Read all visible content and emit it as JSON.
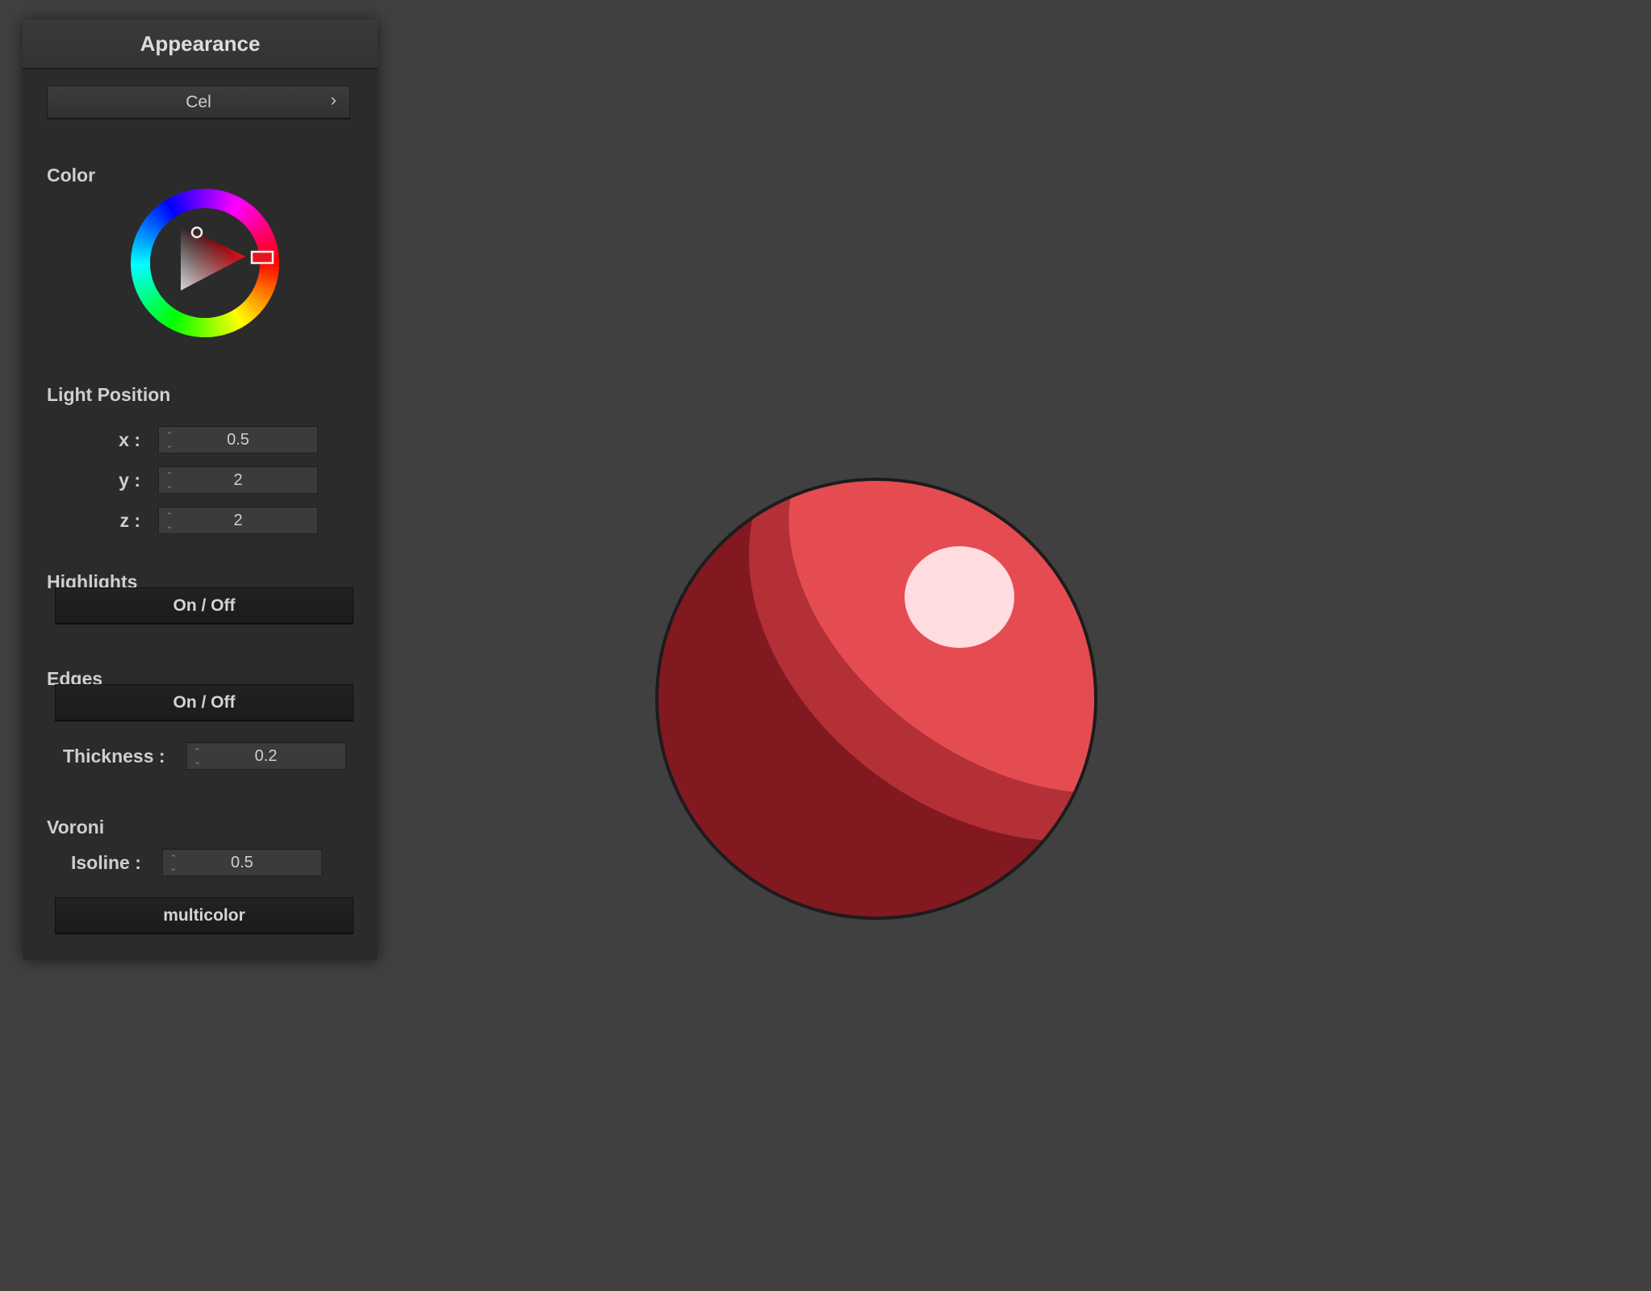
{
  "panel": {
    "title": "Appearance",
    "preset": {
      "label": "Cel",
      "chevron": "›"
    },
    "color_section": {
      "title": "Color",
      "selected_hue_color": "#e8141e"
    },
    "light_position": {
      "title": "Light Position",
      "fields": [
        {
          "label": "x :",
          "value": "0.5"
        },
        {
          "label": "y :",
          "value": "2"
        },
        {
          "label": "z :",
          "value": "2"
        }
      ]
    },
    "highlights": {
      "title": "Highlights",
      "toggle_label": "On / Off"
    },
    "edges": {
      "title": "Edges",
      "toggle_label": "On / Off",
      "thickness": {
        "label": "Thickness :",
        "value": "0.2"
      }
    },
    "voronoi": {
      "title": "Voroni",
      "isoline": {
        "label": "Isoline :",
        "value": "0.5"
      },
      "mode_label": "multicolor"
    }
  },
  "viewport": {
    "object": "sphere",
    "shades": {
      "dark": "#821820",
      "mid": "#b23036",
      "light": "#e54c51",
      "highlight": "#ffdcdf",
      "outline": "#1c1c1c"
    }
  },
  "icons": {
    "spin_up": "chevron-up-icon",
    "spin_down": "chevron-down-icon",
    "preset_more": "chevron-right-icon"
  }
}
